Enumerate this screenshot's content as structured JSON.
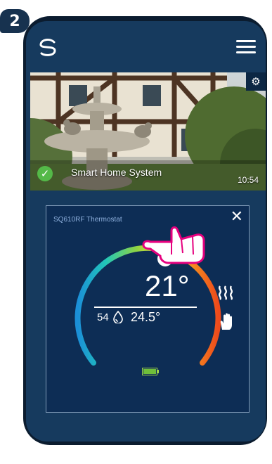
{
  "step": "2",
  "camera": {
    "label": "Smart Home System",
    "time": "10:54"
  },
  "thermostat": {
    "title": "SQ610RF Thermostat",
    "temperature": "21°",
    "humidity": "54",
    "current_temperature": "24.5°"
  },
  "colors": {
    "screen_bg": "#163a5e",
    "card_bg": "#0d2d55",
    "accent_green": "#54b948",
    "hand_pink": "#e6007e"
  },
  "icons": [
    "logo-icon",
    "menu-icon",
    "gear-icon",
    "check-icon",
    "close-icon",
    "humidity-icon",
    "heating-icon",
    "manual-hand-icon",
    "battery-icon",
    "tap-hand-icon"
  ]
}
